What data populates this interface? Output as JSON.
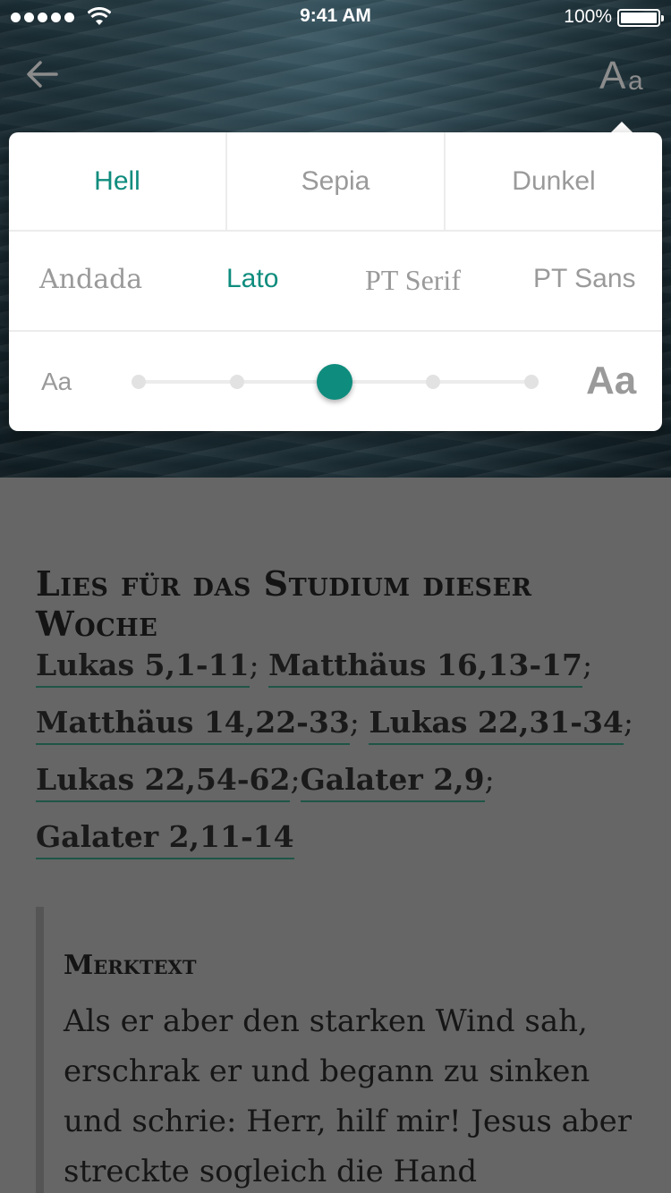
{
  "colors": {
    "accent": "#0e8c7d",
    "link_underline": "#1f5546",
    "overlay": "#666666"
  },
  "status_bar": {
    "time": "9:41 AM",
    "battery": "100%"
  },
  "nav": {
    "back_icon": "arrow-left-icon",
    "text_settings": {
      "large": "A",
      "small": "a"
    }
  },
  "settings": {
    "themes": [
      {
        "label": "Hell",
        "active": true
      },
      {
        "label": "Sepia",
        "active": false
      },
      {
        "label": "Dunkel",
        "active": false
      }
    ],
    "fonts": [
      {
        "label": "Andada",
        "active": false
      },
      {
        "label": "Lato",
        "active": true
      },
      {
        "label": "PT Serif",
        "active": false
      },
      {
        "label": "PT Sans",
        "active": false
      }
    ],
    "font_size": {
      "small_label": "Aa",
      "large_label": "Aa",
      "steps": 5,
      "selected_step": 3
    }
  },
  "content": {
    "section_title": "Lies für das Studium dieser Woche",
    "readings": [
      "Lukas 5,1-11",
      "Matthäus 16,13-17",
      "Matthäus 14,22-33",
      "Lukas 22,31-34",
      "Lukas 22,54-62",
      "Galater 2,9",
      "Galater 2,11-14"
    ],
    "memory_title": "Merktext",
    "memory_text": "Als er aber den starken Wind sah, erschrak er und begann zu sinken und schrie: Herr, hilf mir! Jesus aber streckte sogleich die Hand"
  }
}
